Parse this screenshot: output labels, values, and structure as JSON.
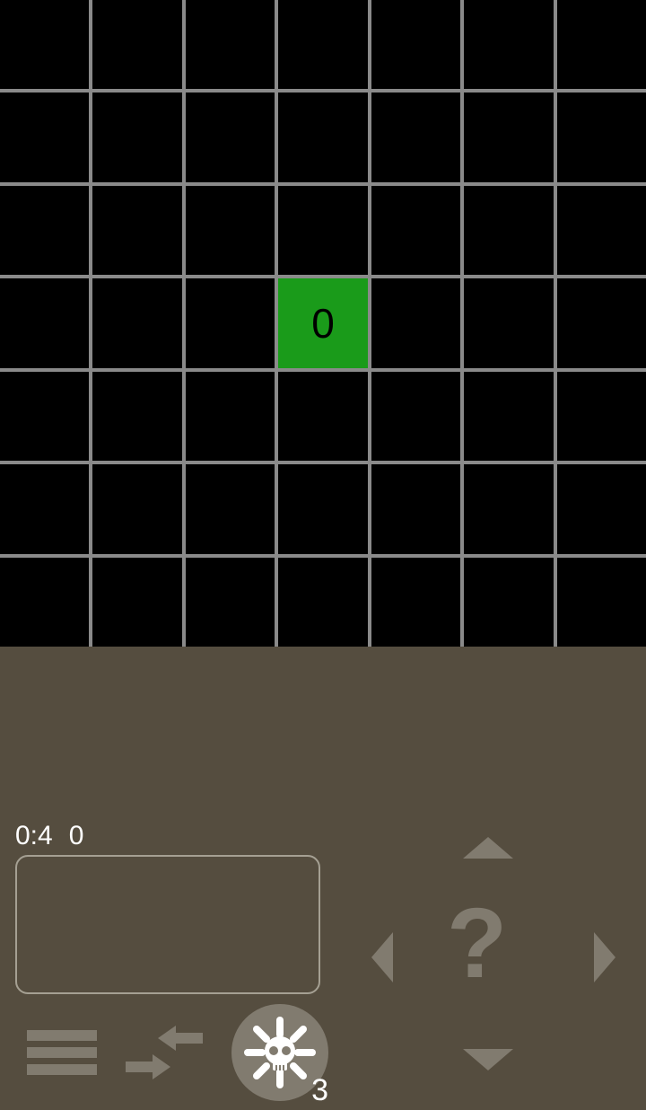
{
  "grid": {
    "size": 7,
    "player_cell": {
      "row": 3,
      "col": 3,
      "value": "0"
    }
  },
  "status": {
    "time": "0:4",
    "score": "0"
  },
  "skull_count": "3",
  "dpad_center_label": "?",
  "colors": {
    "grid_line": "#8a8a8a",
    "cell_bg": "#000000",
    "player_bg": "#1a9b1a",
    "panel_bg": "#554d3f",
    "control_fg": "#817b6f"
  }
}
